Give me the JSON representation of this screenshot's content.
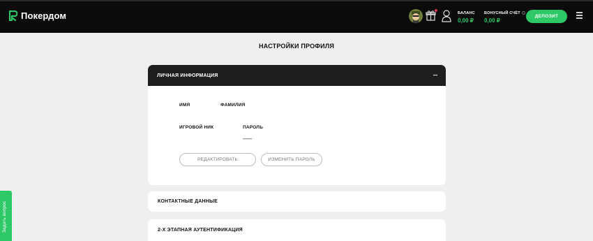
{
  "header": {
    "brand": "Покердом",
    "balance_label": "БАЛАНС",
    "balance_value": "0,00 ₽",
    "bonus_label": "БОНУСНЫЙ СЧЁТ",
    "bonus_value": "0,00 ₽",
    "deposit_label": "ДЕПОЗИТ",
    "icons": [
      "avatar-icon",
      "gift-icon",
      "user-icon",
      "menu-icon"
    ]
  },
  "page": {
    "title": "НАСТРОЙКИ ПРОФИЛЯ"
  },
  "personal": {
    "title": "ЛИЧНАЯ ИНФОРМАЦИЯ",
    "name_label": "ИМЯ",
    "surname_label": "ФАМИЛИЯ",
    "nick_label": "ИГРОВОЙ НИК",
    "password_label": "ПАРОЛЬ",
    "password_value": "••••••••",
    "edit_button": "РЕДАКТИРОВАТЬ",
    "change_password_button": "ИЗМЕНИТЬ ПАРОЛЬ"
  },
  "sections": {
    "contacts": "КОНТАКТНЫЕ ДАННЫЕ",
    "two_factor": "2-Х ЭТАПНАЯ АУТЕНТИФИКАЦИЯ"
  },
  "side_tab": {
    "label": "Задать вопрос"
  },
  "colors": {
    "accent": "#2ec866",
    "header_bg": "#0b0b0b",
    "card_head_bg": "#1e1e1e",
    "page_bg": "#efefef"
  }
}
